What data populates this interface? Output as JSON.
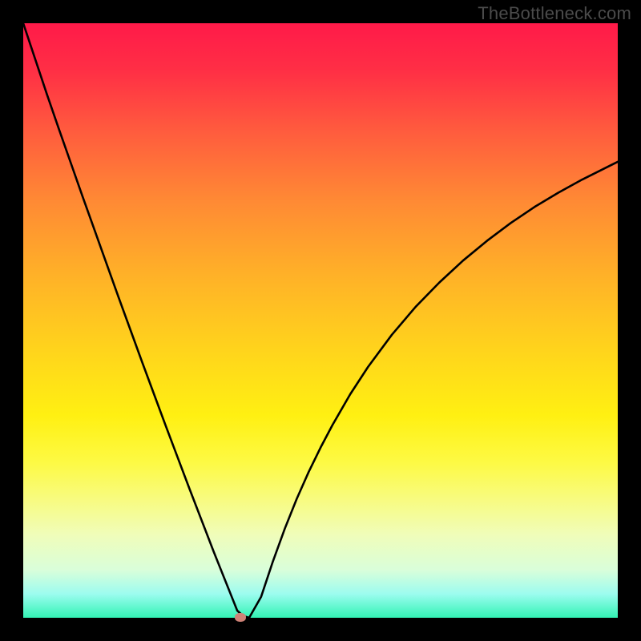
{
  "watermark": "TheBottleneck.com",
  "colors": {
    "frame_bg_top": "#ff1a49",
    "frame_bg_bottom": "#33f3b4",
    "page_bg": "#000000",
    "curve": "#000000",
    "marker": "#cf8277",
    "watermark_text": "#4b4b4b"
  },
  "chart_data": {
    "type": "line",
    "title": "",
    "xlabel": "",
    "ylabel": "",
    "xlim": [
      0,
      100
    ],
    "ylim": [
      0,
      100
    ],
    "grid": false,
    "legend": false,
    "annotations": [],
    "marker": {
      "x": 36.5,
      "y": 0
    },
    "series": [
      {
        "name": "curve",
        "x": [
          0,
          2,
          4,
          6,
          8,
          10,
          12,
          14,
          16,
          18,
          20,
          22,
          24,
          26,
          28,
          30,
          32,
          33,
          34,
          35,
          36,
          37,
          38,
          40,
          42,
          44,
          46,
          48,
          50,
          52,
          55,
          58,
          62,
          66,
          70,
          74,
          78,
          82,
          86,
          90,
          94,
          98,
          100
        ],
        "values": [
          100,
          94,
          88,
          82.2,
          76.5,
          70.8,
          65.2,
          59.6,
          54.0,
          48.5,
          43.0,
          37.6,
          32.2,
          26.9,
          21.6,
          16.4,
          11.2,
          8.7,
          6.2,
          3.7,
          1.2,
          0.3,
          0.0,
          3.5,
          9.5,
          15.0,
          20.0,
          24.5,
          28.6,
          32.4,
          37.6,
          42.2,
          47.6,
          52.3,
          56.4,
          60.1,
          63.4,
          66.4,
          69.1,
          71.5,
          73.7,
          75.7,
          76.7
        ]
      }
    ]
  }
}
